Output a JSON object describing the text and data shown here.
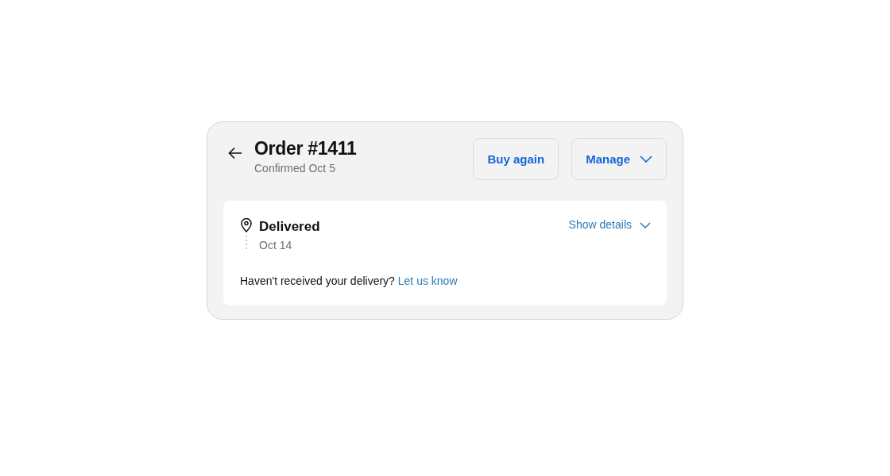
{
  "order": {
    "title": "Order #1411",
    "subtitle": "Confirmed Oct 5"
  },
  "actions": [
    {
      "label": "Buy again",
      "kind": "button"
    },
    {
      "label": "Manage",
      "kind": "dropdown"
    }
  ],
  "status": {
    "title": "Delivered",
    "date": "Oct 14",
    "toggle": "Show details",
    "expanded": false
  },
  "help": {
    "text": "Haven't received your delivery?",
    "link": "Let us know"
  }
}
